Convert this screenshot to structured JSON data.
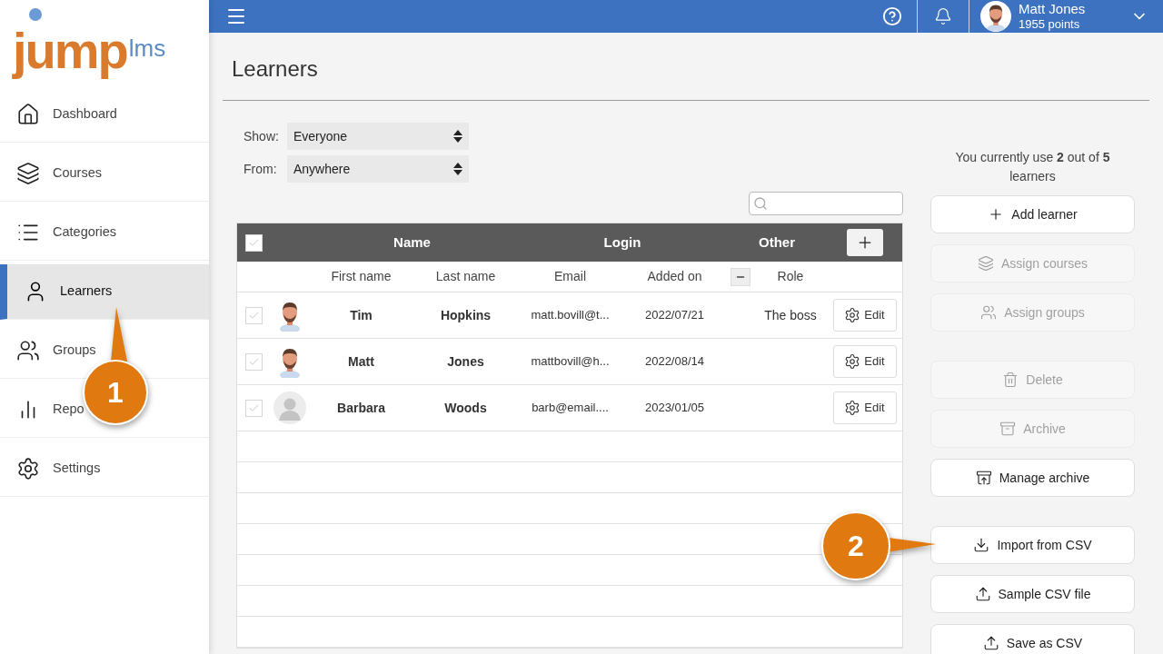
{
  "logo": {
    "main": "jump",
    "suffix": "lms"
  },
  "sidebar": {
    "items": [
      {
        "label": "Dashboard",
        "selected": false
      },
      {
        "label": "Courses",
        "selected": false
      },
      {
        "label": "Categories",
        "selected": false
      },
      {
        "label": "Learners",
        "selected": true
      },
      {
        "label": "Groups",
        "selected": false
      },
      {
        "label": "Repo",
        "selected": false
      },
      {
        "label": "Settings",
        "selected": false
      }
    ]
  },
  "header": {
    "user": {
      "name": "Matt Jones",
      "points": "1955 points"
    }
  },
  "page": {
    "title": "Learners"
  },
  "filters": [
    {
      "label": "Show:",
      "value": "Everyone"
    },
    {
      "label": "From:",
      "value": "Anywhere"
    }
  ],
  "table": {
    "groups": [
      "Name",
      "Login",
      "Other"
    ],
    "columns": [
      "First name",
      "Last name",
      "Email",
      "Added on",
      "Role"
    ],
    "all_checked": false,
    "rows": [
      {
        "checked": false,
        "kind": "photo",
        "first_name": "Tim",
        "last_name": "Hopkins",
        "email": "matt.bovill@t...",
        "added_on": "2022/07/21",
        "role": "The boss",
        "action": "Edit"
      },
      {
        "checked": false,
        "kind": "photo",
        "first_name": "Matt",
        "last_name": "Jones",
        "email": "mattbovill@h...",
        "added_on": "2022/08/14",
        "action": "Edit"
      },
      {
        "checked": false,
        "kind": "placeholder",
        "first_name": "Barbara",
        "last_name": "Woods",
        "email": "barb@email....",
        "added_on": "2023/01/05",
        "action": "Edit"
      }
    ]
  },
  "usage": {
    "text": "You currently use **2** out of **5** learners"
  },
  "actions": [
    [
      {
        "label": "Add learner",
        "disabled": false
      },
      {
        "label": "Assign courses",
        "disabled": true
      },
      {
        "label": "Assign groups",
        "disabled": true
      }
    ],
    [
      {
        "label": "Delete",
        "disabled": true
      },
      {
        "label": "Archive",
        "disabled": true
      },
      {
        "label": "Manage archive",
        "disabled": false
      }
    ],
    [
      {
        "label": "Import from CSV",
        "disabled": false
      },
      {
        "label": "Sample CSV file",
        "disabled": false
      },
      {
        "label": "Save as CSV",
        "disabled": false
      }
    ]
  ],
  "callouts": [
    {
      "number": "1"
    },
    {
      "number": "2"
    }
  ]
}
